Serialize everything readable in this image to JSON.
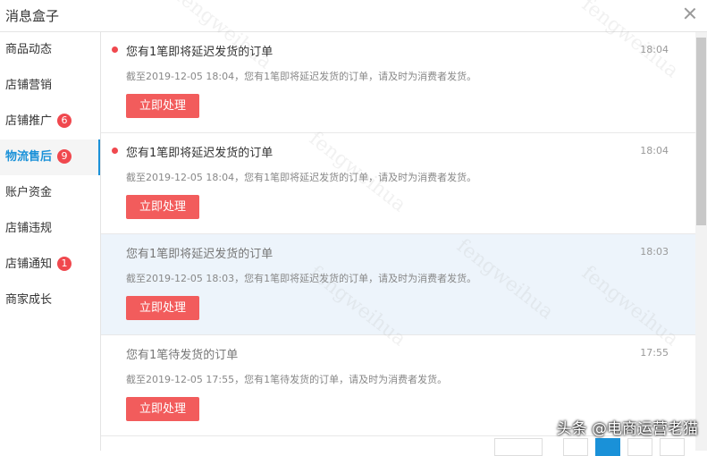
{
  "header": {
    "title": "消息盒子"
  },
  "sidebar": {
    "items": [
      {
        "label": "商品动态",
        "badge": ""
      },
      {
        "label": "店铺营销",
        "badge": ""
      },
      {
        "label": "店铺推广",
        "badge": "6"
      },
      {
        "label": "物流售后",
        "badge": "9"
      },
      {
        "label": "账户资金",
        "badge": ""
      },
      {
        "label": "店铺违规",
        "badge": ""
      },
      {
        "label": "店铺通知",
        "badge": "1"
      },
      {
        "label": "商家成长",
        "badge": ""
      }
    ]
  },
  "messages": [
    {
      "title": "您有1笔即将延迟发货的订单",
      "time": "18:04",
      "desc": "截至2019-12-05 18:04，您有1笔即将延迟发货的订单，请及时为消费者发货。",
      "button": "立即处理"
    },
    {
      "title": "您有1笔即将延迟发货的订单",
      "time": "18:04",
      "desc": "截至2019-12-05 18:04，您有1笔即将延迟发货的订单，请及时为消费者发货。",
      "button": "立即处理"
    },
    {
      "title": "您有1笔即将延迟发货的订单",
      "time": "18:03",
      "desc": "截至2019-12-05 18:03，您有1笔即将延迟发货的订单，请及时为消费者发货。",
      "button": "立即处理"
    },
    {
      "title": "您有1笔待发货的订单",
      "time": "17:55",
      "desc": "截至2019-12-05 17:55，您有1笔待发货的订单，请及时为消费者发货。",
      "button": "立即处理"
    }
  ],
  "watermark": {
    "caption": "头条 @电商运营老猫",
    "pattern": "fengweihua"
  },
  "colors": {
    "accent": "#1a91d8",
    "badge": "#f0484e",
    "button": "#f25c5c",
    "highlight_row": "#edf4fb"
  }
}
